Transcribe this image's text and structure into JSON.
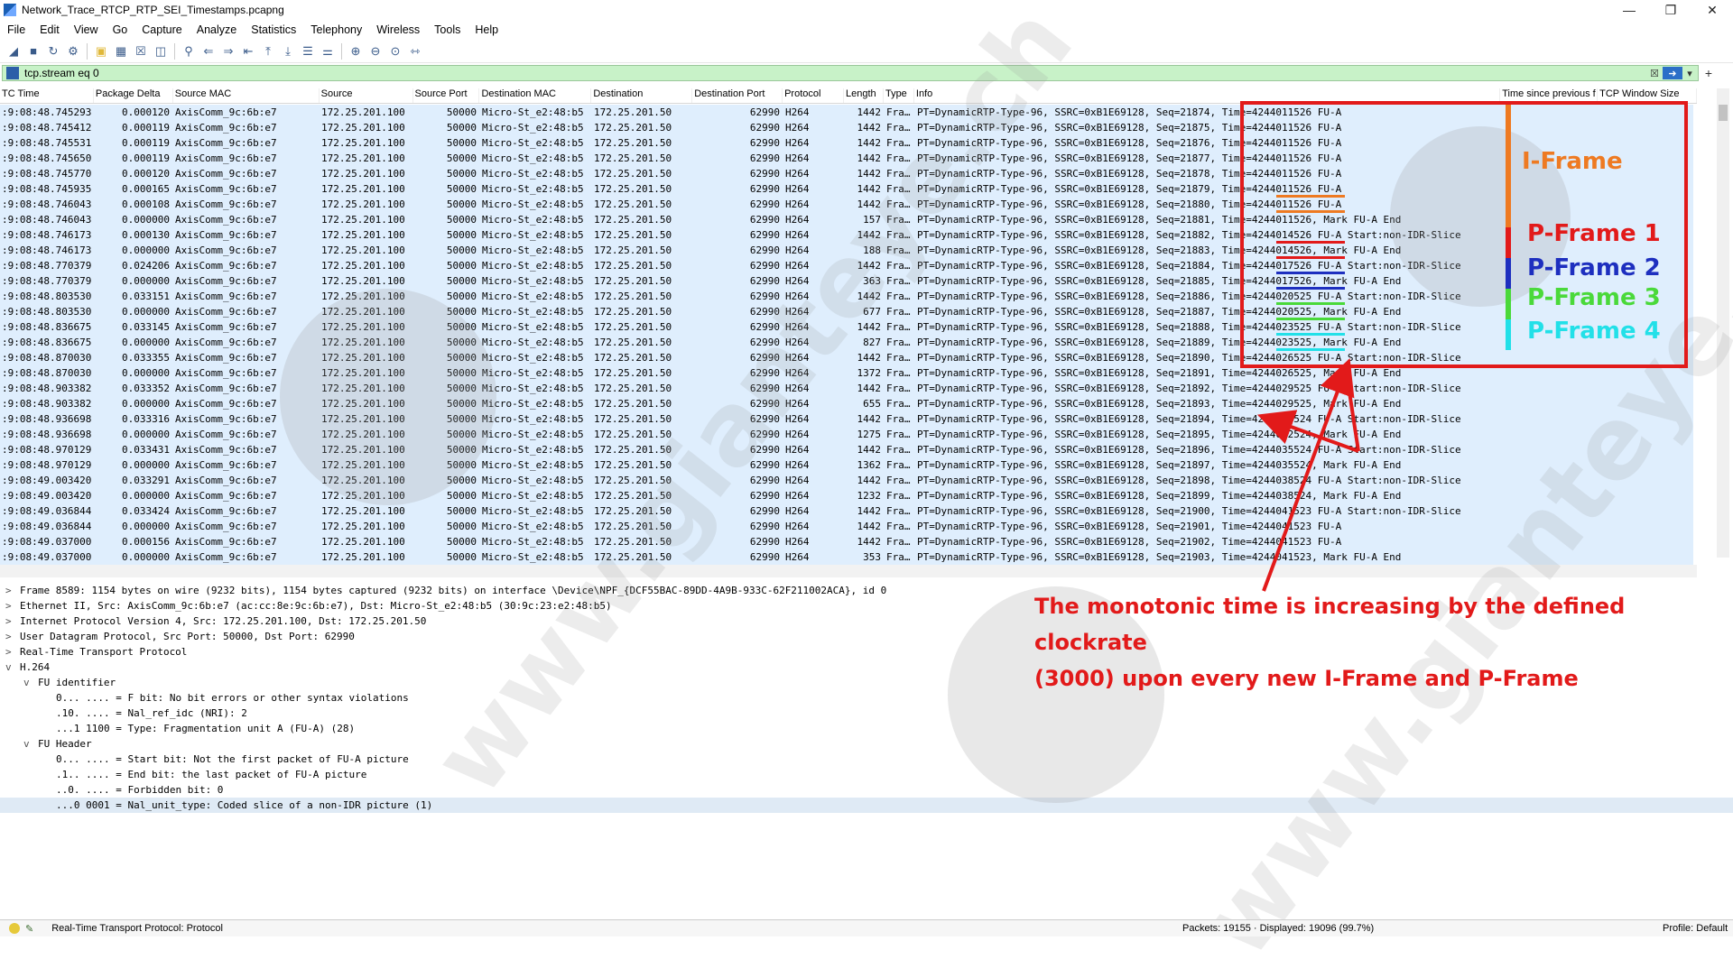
{
  "window": {
    "title": "Network_Trace_RTCP_RTP_SEI_Timestamps.pcapng"
  },
  "menu": [
    "File",
    "Edit",
    "View",
    "Go",
    "Capture",
    "Analyze",
    "Statistics",
    "Telephony",
    "Wireless",
    "Tools",
    "Help"
  ],
  "filter": {
    "value": "tcp.stream eq 0"
  },
  "columns": [
    "TC Time",
    "Package Delta",
    "Source MAC",
    "Source",
    "Source Port",
    "Destination MAC",
    "Destination",
    "Destination Port",
    "Protocol",
    "Length",
    "Type",
    "Info",
    "Time since previous f",
    "TCP Window Size"
  ],
  "rows": [
    [
      ":9:08:48.745293",
      "0.000120",
      "AxisComm_9c:6b:e7",
      "172.25.201.100",
      "50000",
      "Micro-St_e2:48:b5",
      "172.25.201.50",
      "62990",
      "H264",
      "1442",
      "Fra…",
      "PT=DynamicRTP-Type-96, SSRC=0xB1E69128, Seq=21874, Time=4244011526 FU-A"
    ],
    [
      ":9:08:48.745412",
      "0.000119",
      "AxisComm_9c:6b:e7",
      "172.25.201.100",
      "50000",
      "Micro-St_e2:48:b5",
      "172.25.201.50",
      "62990",
      "H264",
      "1442",
      "Fra…",
      "PT=DynamicRTP-Type-96, SSRC=0xB1E69128, Seq=21875, Time=4244011526 FU-A"
    ],
    [
      ":9:08:48.745531",
      "0.000119",
      "AxisComm_9c:6b:e7",
      "172.25.201.100",
      "50000",
      "Micro-St_e2:48:b5",
      "172.25.201.50",
      "62990",
      "H264",
      "1442",
      "Fra…",
      "PT=DynamicRTP-Type-96, SSRC=0xB1E69128, Seq=21876, Time=4244011526 FU-A"
    ],
    [
      ":9:08:48.745650",
      "0.000119",
      "AxisComm_9c:6b:e7",
      "172.25.201.100",
      "50000",
      "Micro-St_e2:48:b5",
      "172.25.201.50",
      "62990",
      "H264",
      "1442",
      "Fra…",
      "PT=DynamicRTP-Type-96, SSRC=0xB1E69128, Seq=21877, Time=4244011526 FU-A"
    ],
    [
      ":9:08:48.745770",
      "0.000120",
      "AxisComm_9c:6b:e7",
      "172.25.201.100",
      "50000",
      "Micro-St_e2:48:b5",
      "172.25.201.50",
      "62990",
      "H264",
      "1442",
      "Fra…",
      "PT=DynamicRTP-Type-96, SSRC=0xB1E69128, Seq=21878, Time=4244011526 FU-A"
    ],
    [
      ":9:08:48.745935",
      "0.000165",
      "AxisComm_9c:6b:e7",
      "172.25.201.100",
      "50000",
      "Micro-St_e2:48:b5",
      "172.25.201.50",
      "62990",
      "H264",
      "1442",
      "Fra…",
      "PT=DynamicRTP-Type-96, SSRC=0xB1E69128, Seq=21879, Time=4244011526 FU-A"
    ],
    [
      ":9:08:48.746043",
      "0.000108",
      "AxisComm_9c:6b:e7",
      "172.25.201.100",
      "50000",
      "Micro-St_e2:48:b5",
      "172.25.201.50",
      "62990",
      "H264",
      "1442",
      "Fra…",
      "PT=DynamicRTP-Type-96, SSRC=0xB1E69128, Seq=21880, Time=4244011526 FU-A"
    ],
    [
      ":9:08:48.746043",
      "0.000000",
      "AxisComm_9c:6b:e7",
      "172.25.201.100",
      "50000",
      "Micro-St_e2:48:b5",
      "172.25.201.50",
      "62990",
      "H264",
      "157",
      "Fra…",
      "PT=DynamicRTP-Type-96, SSRC=0xB1E69128, Seq=21881, Time=4244011526, Mark FU-A End"
    ],
    [
      ":9:08:48.746173",
      "0.000130",
      "AxisComm_9c:6b:e7",
      "172.25.201.100",
      "50000",
      "Micro-St_e2:48:b5",
      "172.25.201.50",
      "62990",
      "H264",
      "1442",
      "Fra…",
      "PT=DynamicRTP-Type-96, SSRC=0xB1E69128, Seq=21882, Time=4244014526 FU-A Start:non-IDR-Slice"
    ],
    [
      ":9:08:48.746173",
      "0.000000",
      "AxisComm_9c:6b:e7",
      "172.25.201.100",
      "50000",
      "Micro-St_e2:48:b5",
      "172.25.201.50",
      "62990",
      "H264",
      "188",
      "Fra…",
      "PT=DynamicRTP-Type-96, SSRC=0xB1E69128, Seq=21883, Time=4244014526, Mark FU-A End"
    ],
    [
      ":9:08:48.770379",
      "0.024206",
      "AxisComm_9c:6b:e7",
      "172.25.201.100",
      "50000",
      "Micro-St_e2:48:b5",
      "172.25.201.50",
      "62990",
      "H264",
      "1442",
      "Fra…",
      "PT=DynamicRTP-Type-96, SSRC=0xB1E69128, Seq=21884, Time=4244017526 FU-A Start:non-IDR-Slice"
    ],
    [
      ":9:08:48.770379",
      "0.000000",
      "AxisComm_9c:6b:e7",
      "172.25.201.100",
      "50000",
      "Micro-St_e2:48:b5",
      "172.25.201.50",
      "62990",
      "H264",
      "363",
      "Fra…",
      "PT=DynamicRTP-Type-96, SSRC=0xB1E69128, Seq=21885, Time=4244017526, Mark FU-A End"
    ],
    [
      ":9:08:48.803530",
      "0.033151",
      "AxisComm_9c:6b:e7",
      "172.25.201.100",
      "50000",
      "Micro-St_e2:48:b5",
      "172.25.201.50",
      "62990",
      "H264",
      "1442",
      "Fra…",
      "PT=DynamicRTP-Type-96, SSRC=0xB1E69128, Seq=21886, Time=4244020525 FU-A Start:non-IDR-Slice"
    ],
    [
      ":9:08:48.803530",
      "0.000000",
      "AxisComm_9c:6b:e7",
      "172.25.201.100",
      "50000",
      "Micro-St_e2:48:b5",
      "172.25.201.50",
      "62990",
      "H264",
      "677",
      "Fra…",
      "PT=DynamicRTP-Type-96, SSRC=0xB1E69128, Seq=21887, Time=4244020525, Mark FU-A End"
    ],
    [
      ":9:08:48.836675",
      "0.033145",
      "AxisComm_9c:6b:e7",
      "172.25.201.100",
      "50000",
      "Micro-St_e2:48:b5",
      "172.25.201.50",
      "62990",
      "H264",
      "1442",
      "Fra…",
      "PT=DynamicRTP-Type-96, SSRC=0xB1E69128, Seq=21888, Time=4244023525 FU-A Start:non-IDR-Slice"
    ],
    [
      ":9:08:48.836675",
      "0.000000",
      "AxisComm_9c:6b:e7",
      "172.25.201.100",
      "50000",
      "Micro-St_e2:48:b5",
      "172.25.201.50",
      "62990",
      "H264",
      "827",
      "Fra…",
      "PT=DynamicRTP-Type-96, SSRC=0xB1E69128, Seq=21889, Time=4244023525, Mark FU-A End"
    ],
    [
      ":9:08:48.870030",
      "0.033355",
      "AxisComm_9c:6b:e7",
      "172.25.201.100",
      "50000",
      "Micro-St_e2:48:b5",
      "172.25.201.50",
      "62990",
      "H264",
      "1442",
      "Fra…",
      "PT=DynamicRTP-Type-96, SSRC=0xB1E69128, Seq=21890, Time=4244026525 FU-A Start:non-IDR-Slice"
    ],
    [
      ":9:08:48.870030",
      "0.000000",
      "AxisComm_9c:6b:e7",
      "172.25.201.100",
      "50000",
      "Micro-St_e2:48:b5",
      "172.25.201.50",
      "62990",
      "H264",
      "1372",
      "Fra…",
      "PT=DynamicRTP-Type-96, SSRC=0xB1E69128, Seq=21891, Time=4244026525, Mark FU-A End"
    ],
    [
      ":9:08:48.903382",
      "0.033352",
      "AxisComm_9c:6b:e7",
      "172.25.201.100",
      "50000",
      "Micro-St_e2:48:b5",
      "172.25.201.50",
      "62990",
      "H264",
      "1442",
      "Fra…",
      "PT=DynamicRTP-Type-96, SSRC=0xB1E69128, Seq=21892, Time=4244029525 FU-A Start:non-IDR-Slice"
    ],
    [
      ":9:08:48.903382",
      "0.000000",
      "AxisComm_9c:6b:e7",
      "172.25.201.100",
      "50000",
      "Micro-St_e2:48:b5",
      "172.25.201.50",
      "62990",
      "H264",
      "655",
      "Fra…",
      "PT=DynamicRTP-Type-96, SSRC=0xB1E69128, Seq=21893, Time=4244029525, Mark FU-A End"
    ],
    [
      ":9:08:48.936698",
      "0.033316",
      "AxisComm_9c:6b:e7",
      "172.25.201.100",
      "50000",
      "Micro-St_e2:48:b5",
      "172.25.201.50",
      "62990",
      "H264",
      "1442",
      "Fra…",
      "PT=DynamicRTP-Type-96, SSRC=0xB1E69128, Seq=21894, Time=4244032524 FU-A Start:non-IDR-Slice"
    ],
    [
      ":9:08:48.936698",
      "0.000000",
      "AxisComm_9c:6b:e7",
      "172.25.201.100",
      "50000",
      "Micro-St_e2:48:b5",
      "172.25.201.50",
      "62990",
      "H264",
      "1275",
      "Fra…",
      "PT=DynamicRTP-Type-96, SSRC=0xB1E69128, Seq=21895, Time=4244032524, Mark FU-A End"
    ],
    [
      ":9:08:48.970129",
      "0.033431",
      "AxisComm_9c:6b:e7",
      "172.25.201.100",
      "50000",
      "Micro-St_e2:48:b5",
      "172.25.201.50",
      "62990",
      "H264",
      "1442",
      "Fra…",
      "PT=DynamicRTP-Type-96, SSRC=0xB1E69128, Seq=21896, Time=4244035524 FU-A Start:non-IDR-Slice"
    ],
    [
      ":9:08:48.970129",
      "0.000000",
      "AxisComm_9c:6b:e7",
      "172.25.201.100",
      "50000",
      "Micro-St_e2:48:b5",
      "172.25.201.50",
      "62990",
      "H264",
      "1362",
      "Fra…",
      "PT=DynamicRTP-Type-96, SSRC=0xB1E69128, Seq=21897, Time=4244035524, Mark FU-A End"
    ],
    [
      ":9:08:49.003420",
      "0.033291",
      "AxisComm_9c:6b:e7",
      "172.25.201.100",
      "50000",
      "Micro-St_e2:48:b5",
      "172.25.201.50",
      "62990",
      "H264",
      "1442",
      "Fra…",
      "PT=DynamicRTP-Type-96, SSRC=0xB1E69128, Seq=21898, Time=4244038524 FU-A Start:non-IDR-Slice"
    ],
    [
      ":9:08:49.003420",
      "0.000000",
      "AxisComm_9c:6b:e7",
      "172.25.201.100",
      "50000",
      "Micro-St_e2:48:b5",
      "172.25.201.50",
      "62990",
      "H264",
      "1232",
      "Fra…",
      "PT=DynamicRTP-Type-96, SSRC=0xB1E69128, Seq=21899, Time=4244038524, Mark FU-A End"
    ],
    [
      ":9:08:49.036844",
      "0.033424",
      "AxisComm_9c:6b:e7",
      "172.25.201.100",
      "50000",
      "Micro-St_e2:48:b5",
      "172.25.201.50",
      "62990",
      "H264",
      "1442",
      "Fra…",
      "PT=DynamicRTP-Type-96, SSRC=0xB1E69128, Seq=21900, Time=4244041523 FU-A Start:non-IDR-Slice"
    ],
    [
      ":9:08:49.036844",
      "0.000000",
      "AxisComm_9c:6b:e7",
      "172.25.201.100",
      "50000",
      "Micro-St_e2:48:b5",
      "172.25.201.50",
      "62990",
      "H264",
      "1442",
      "Fra…",
      "PT=DynamicRTP-Type-96, SSRC=0xB1E69128, Seq=21901, Time=4244041523 FU-A"
    ],
    [
      ":9:08:49.037000",
      "0.000156",
      "AxisComm_9c:6b:e7",
      "172.25.201.100",
      "50000",
      "Micro-St_e2:48:b5",
      "172.25.201.50",
      "62990",
      "H264",
      "1442",
      "Fra…",
      "PT=DynamicRTP-Type-96, SSRC=0xB1E69128, Seq=21902, Time=4244041523 FU-A"
    ],
    [
      ":9:08:49.037000",
      "0.000000",
      "AxisComm_9c:6b:e7",
      "172.25.201.100",
      "50000",
      "Micro-St_e2:48:b5",
      "172.25.201.50",
      "62990",
      "H264",
      "353",
      "Fra…",
      "PT=DynamicRTP-Type-96, SSRC=0xB1E69128, Seq=21903, Time=4244041523, Mark FU-A End"
    ]
  ],
  "details": [
    {
      "indent": 0,
      "arrow": ">",
      "text": "Frame 8589: 1154 bytes on wire (9232 bits), 1154 bytes captured (9232 bits) on interface \\Device\\NPF_{DCF55BAC-89DD-4A9B-933C-62F211002ACA}, id 0"
    },
    {
      "indent": 0,
      "arrow": ">",
      "text": "Ethernet II, Src: AxisComm_9c:6b:e7 (ac:cc:8e:9c:6b:e7), Dst: Micro-St_e2:48:b5 (30:9c:23:e2:48:b5)"
    },
    {
      "indent": 0,
      "arrow": ">",
      "text": "Internet Protocol Version 4, Src: 172.25.201.100, Dst: 172.25.201.50"
    },
    {
      "indent": 0,
      "arrow": ">",
      "text": "User Datagram Protocol, Src Port: 50000, Dst Port: 62990"
    },
    {
      "indent": 0,
      "arrow": ">",
      "text": "Real-Time Transport Protocol"
    },
    {
      "indent": 0,
      "arrow": "v",
      "text": "H.264"
    },
    {
      "indent": 1,
      "arrow": "v",
      "text": "FU identifier"
    },
    {
      "indent": 2,
      "arrow": "",
      "text": "0... .... = F bit: No bit errors or other syntax violations"
    },
    {
      "indent": 2,
      "arrow": "",
      "text": ".10. .... = Nal_ref_idc (NRI): 2"
    },
    {
      "indent": 2,
      "arrow": "",
      "text": "...1 1100 = Type: Fragmentation unit A (FU-A) (28)"
    },
    {
      "indent": 1,
      "arrow": "v",
      "text": "FU Header"
    },
    {
      "indent": 2,
      "arrow": "",
      "text": "0... .... = Start bit: Not the first packet of FU-A picture"
    },
    {
      "indent": 2,
      "arrow": "",
      "text": ".1.. .... = End bit: the last packet of FU-A picture"
    },
    {
      "indent": 2,
      "arrow": "",
      "text": "..0. .... = Forbidden bit: 0"
    },
    {
      "indent": 2,
      "arrow": "",
      "text": "...0 0001 = Nal_unit_type: Coded slice of a non-IDR picture (1)"
    }
  ],
  "annotations": {
    "labels": [
      {
        "text": "I-Frame",
        "color": "#ee7a22"
      },
      {
        "text": "P-Frame 1",
        "color": "#e21a1a"
      },
      {
        "text": "P-Frame 2",
        "color": "#1e2fbf"
      },
      {
        "text": "P-Frame 3",
        "color": "#4ad93a"
      },
      {
        "text": "P-Frame 4",
        "color": "#22e0e8"
      }
    ],
    "note_line1": "The monotonic time is increasing by the defined clockrate",
    "note_line2": "(3000) upon every new I-Frame and P-Frame",
    "watermark": "www.gianteye.ch",
    "watermark_logo": "GIANTEYE"
  },
  "status": {
    "protocol": "Real-Time Transport Protocol: Protocol",
    "packets": "Packets: 19155 · Displayed: 19096 (99.7%)",
    "profile": "Profile: Default"
  },
  "colors": {
    "filter_bg": "#c8f2c8",
    "row_bg": "#dfeefd",
    "annotation": "#e21a1a"
  }
}
